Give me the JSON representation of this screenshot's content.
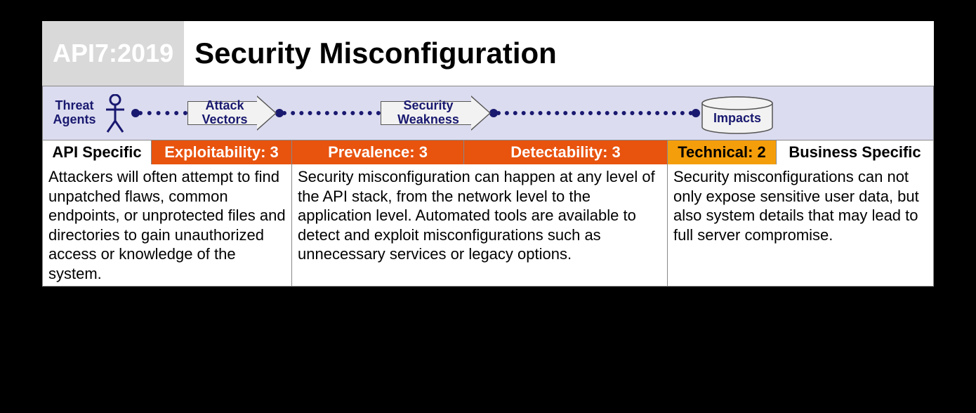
{
  "header": {
    "badge": "API7:2019",
    "title": "Security Misconfiguration"
  },
  "flow": {
    "threat_agents": "Threat Agents",
    "attack_vectors": "Attack Vectors",
    "security_weakness": "Security Weakness",
    "impacts": "Impacts"
  },
  "ratings": {
    "api_specific": "API Specific",
    "exploitability": "Exploitability: 3",
    "prevalence": "Prevalence: 3",
    "detectability": "Detectability: 3",
    "technical": "Technical: 2",
    "business_specific": "Business Specific"
  },
  "descriptions": {
    "col1": "Attackers will often attempt to find unpatched flaws, common endpoints, or unprotected files and directories to gain unauthorized access or knowledge of the system.",
    "col2": "Security misconfiguration can happen at any level of the API stack, from the network level to the application level. Automated tools are available to detect and exploit misconfigurations such as unnecessary services or legacy options.",
    "col3": "Security misconfigurations can not only expose sensitive user data, but also system details that may lead to full server compromise."
  }
}
